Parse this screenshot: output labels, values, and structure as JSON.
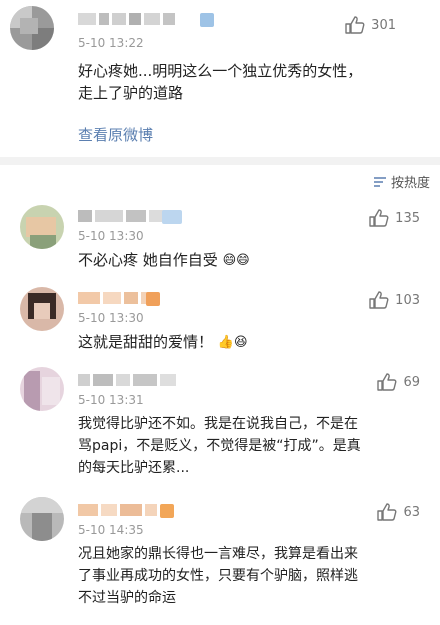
{
  "main_post": {
    "time": "5-10 13:22",
    "likes": "301",
    "text_lines": [
      "好心疼她...明明这么一个独立优秀的女性，",
      "走上了驴的道路"
    ],
    "view_original": "查看原微博"
  },
  "sort": {
    "label": "按热度",
    "icon": "sort-lines-icon"
  },
  "comments": [
    {
      "time": "5-10 13:30",
      "likes": "135",
      "text_lines": [
        "不必心疼 她自作自受"
      ],
      "emoji": [
        "smile-emoji",
        "smile-emoji"
      ]
    },
    {
      "time": "5-10 13:30",
      "likes": "103",
      "text_lines": [
        "这就是甜甜的爱情！"
      ],
      "emoji": [
        "thumb-emoji",
        "laugh-emoji"
      ]
    },
    {
      "time": "5-10 13:31",
      "likes": "69",
      "text_lines": [
        "我觉得比驴还不如。我是在说我自己，不是在",
        "骂papi，不是贬义，不觉得是被“打成”。是真",
        "的每天比驴还累..."
      ]
    },
    {
      "time": "5-10 14:35",
      "likes": "63",
      "text_lines": [
        "况且她家的鼎长得也一言难尽，我算是看出来",
        "了事业再成功的女性，只要有个驴脑，照样逃",
        "不过当驴的命运"
      ]
    }
  ],
  "colors": {
    "link": "#5b7fb0",
    "time": "#999999",
    "background": "#f2f2f2"
  }
}
